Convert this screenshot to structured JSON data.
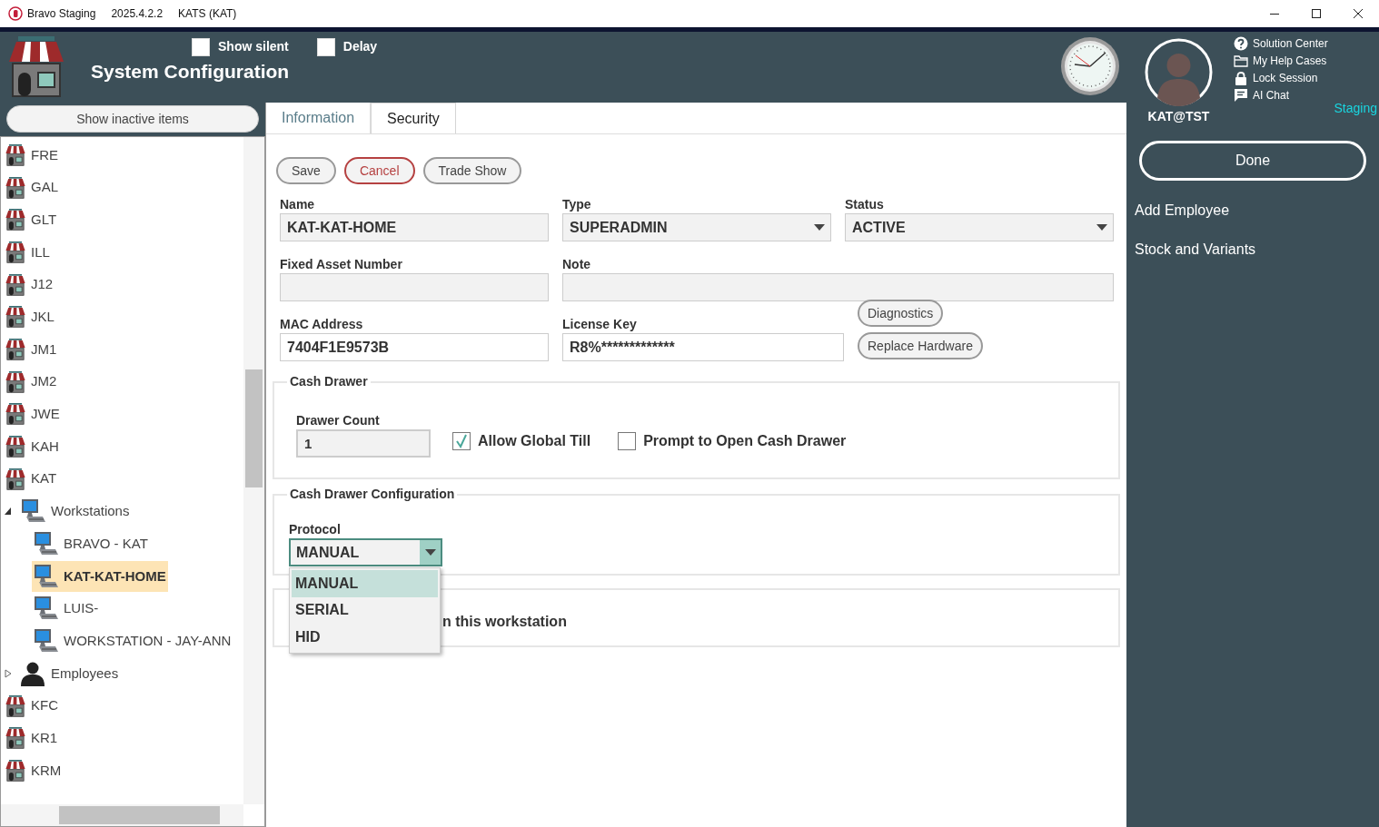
{
  "title_bar": {
    "app": "Bravo Staging",
    "version": "2025.4.2.2",
    "store": "KATS (KAT)"
  },
  "header": {
    "title": "System Configuration",
    "options": [
      {
        "label": "Show silent",
        "checked": false
      },
      {
        "label": "Delay",
        "checked": false
      }
    ]
  },
  "sidebar": {
    "show_inactive_button": "Show inactive items",
    "tree": [
      {
        "label": "FRE",
        "kind": "store",
        "selected": false
      },
      {
        "label": "GAL",
        "kind": "store",
        "selected": false
      },
      {
        "label": "GLT",
        "kind": "store",
        "selected": false
      },
      {
        "label": "ILL",
        "kind": "store",
        "selected": false
      },
      {
        "label": "J12",
        "kind": "store",
        "selected": false
      },
      {
        "label": "JKL",
        "kind": "store",
        "selected": false
      },
      {
        "label": "JM1",
        "kind": "store",
        "selected": false
      },
      {
        "label": "JM2",
        "kind": "store",
        "selected": false
      },
      {
        "label": "JWE",
        "kind": "store",
        "selected": false
      },
      {
        "label": "KAH",
        "kind": "store",
        "selected": false
      },
      {
        "label": "KAT",
        "kind": "store",
        "selected": false
      },
      {
        "label": "Workstations",
        "kind": "computer",
        "selected": false,
        "expanded": true,
        "children": [
          {
            "label": "BRAVO - KAT",
            "kind": "computer",
            "selected": false
          },
          {
            "label": "KAT-KAT-HOME",
            "kind": "computer",
            "selected": true
          },
          {
            "label": "LUIS-",
            "kind": "computer",
            "selected": false
          },
          {
            "label": "WORKSTATION - JAY-ANN",
            "kind": "computer",
            "selected": false
          }
        ]
      },
      {
        "label": "Employees",
        "kind": "person",
        "selected": false,
        "expanded": false
      },
      {
        "label": "KFC",
        "kind": "store",
        "selected": false
      },
      {
        "label": "KR1",
        "kind": "store",
        "selected": false
      },
      {
        "label": "KRM",
        "kind": "store",
        "selected": false
      }
    ]
  },
  "tabs": [
    {
      "label": "Information",
      "selected": true
    },
    {
      "label": "Security",
      "selected": false
    }
  ],
  "toolbar": [
    {
      "label": "Save",
      "kind": "default"
    },
    {
      "label": "Cancel",
      "kind": "danger"
    },
    {
      "label": "Trade Show",
      "kind": "default"
    }
  ],
  "form": {
    "name": {
      "label": "Name",
      "value": "KAT-KAT-HOME",
      "read_only": true
    },
    "type": {
      "label": "Type",
      "value": "SUPERADMIN"
    },
    "status": {
      "label": "Status",
      "value": "ACTIVE"
    },
    "fixed_asset_number": {
      "label": "Fixed Asset Number",
      "read_only": true
    },
    "note": {
      "label": "Note",
      "read_only": true
    },
    "mac_address": {
      "label": "MAC Address",
      "value": "7404F1E9573B",
      "read_only": false
    },
    "license_key": {
      "label": "License Key",
      "value": "R8%*************",
      "read_only": false
    }
  },
  "hardware_buttons": [
    "Diagnostics",
    "Replace Hardware"
  ],
  "cash_drawer": {
    "title": "Cash Drawer",
    "drawer_count": {
      "label": "Drawer Count",
      "value": "1",
      "read_only": true
    },
    "options": [
      {
        "label": "Allow Global Till",
        "checked": true
      },
      {
        "label": "Prompt to Open Cash Drawer",
        "checked": false
      }
    ]
  },
  "cash_drawer_configuration": {
    "title": "Cash Drawer Configuration",
    "protocol": {
      "label": "Protocol",
      "value": "MANUAL",
      "expanded": true,
      "options": [
        {
          "label": "MANUAL",
          "selected": true
        },
        {
          "label": "SERIAL",
          "selected": false
        },
        {
          "label": "HID",
          "selected": false
        }
      ]
    }
  },
  "next_section": {
    "text": "n this workstation"
  },
  "user_panel": {
    "username": "KAT@TST",
    "links": [
      {
        "label": "Solution Center",
        "kind": "help"
      },
      {
        "label": "My Help Cases",
        "kind": "folder"
      },
      {
        "label": "Lock Session",
        "kind": "lock"
      },
      {
        "label": "AI Chat",
        "kind": "chat"
      }
    ],
    "environment": "Staging"
  },
  "actions": {
    "done": "Done",
    "items": [
      "Add Employee",
      "Stock and Variants"
    ]
  }
}
